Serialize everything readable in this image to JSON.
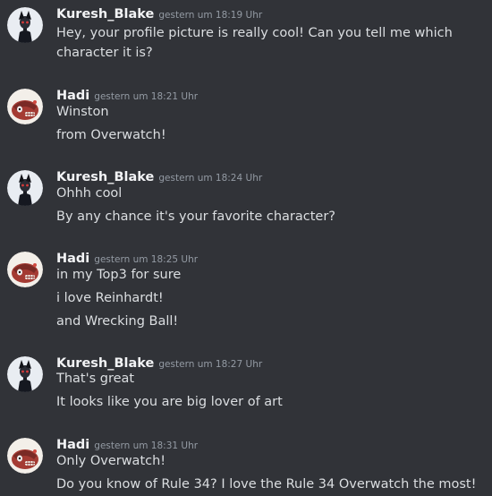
{
  "groups": [
    {
      "username": "Kuresh_Blake",
      "timestamp": "gestern um 18:19 Uhr",
      "avatar_icon": "kuresh-avatar-icon",
      "messages": [
        "Hey, your profile picture is really cool! Can you tell me which character it is?"
      ]
    },
    {
      "username": "Hadi",
      "timestamp": "gestern um 18:21 Uhr",
      "avatar_icon": "hadi-avatar-icon",
      "messages": [
        "Winston",
        "from Overwatch!"
      ]
    },
    {
      "username": "Kuresh_Blake",
      "timestamp": "gestern um 18:24 Uhr",
      "avatar_icon": "kuresh-avatar-icon",
      "messages": [
        "Ohhh cool",
        "By any chance it's your favorite character?"
      ]
    },
    {
      "username": "Hadi",
      "timestamp": "gestern um 18:25 Uhr",
      "avatar_icon": "hadi-avatar-icon",
      "messages": [
        "in my Top3 for sure",
        "i love Reinhardt!",
        "and Wrecking Ball!"
      ]
    },
    {
      "username": "Kuresh_Blake",
      "timestamp": "gestern um 18:27 Uhr",
      "avatar_icon": "kuresh-avatar-icon",
      "messages": [
        "That's great",
        "It looks like you are big lover of art"
      ]
    },
    {
      "username": "Hadi",
      "timestamp": "gestern um 18:31 Uhr",
      "avatar_icon": "hadi-avatar-icon",
      "messages": [
        "Only Overwatch!",
        "Do you know of Rule 34? I love the Rule 34 Overwatch the most!"
      ]
    }
  ],
  "colors": {
    "background": "#313338",
    "username": "#f2f3f5",
    "timestamp": "#949ba4",
    "message_text": "#dbdee1"
  }
}
